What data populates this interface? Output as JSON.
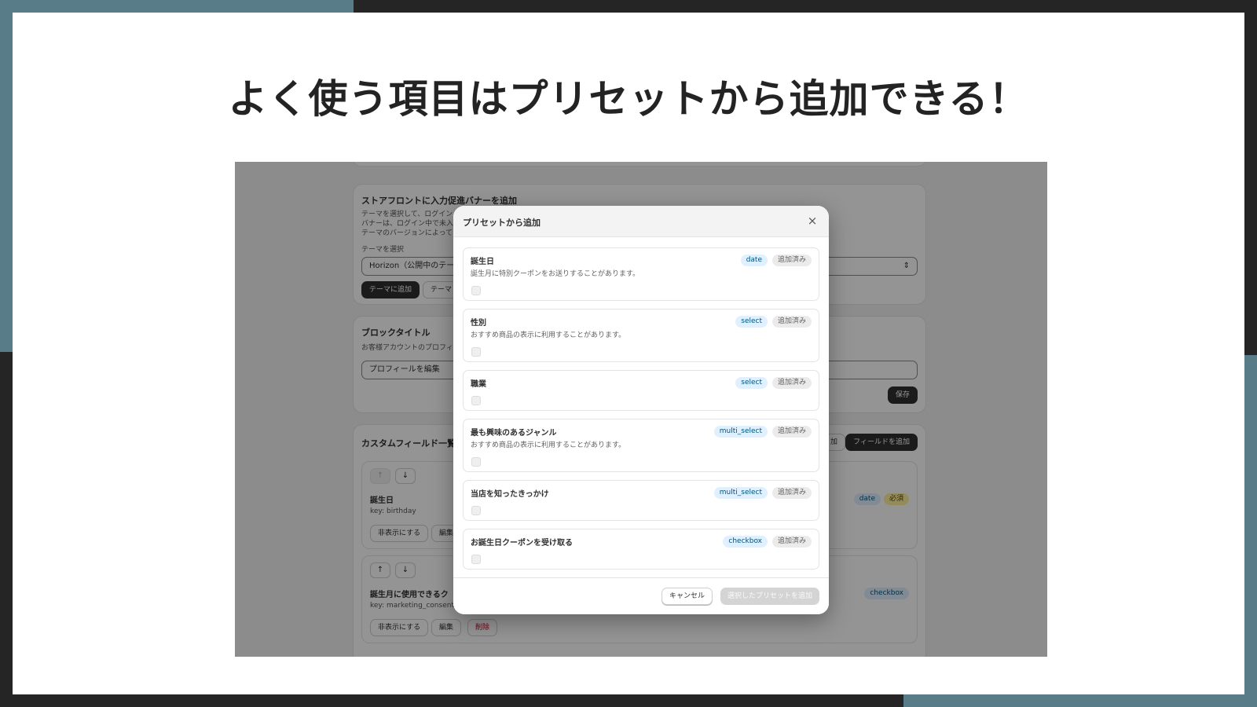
{
  "headline": "よく使う項目はプリセットから追加できる！",
  "app": {
    "banner_card": {
      "title": "ストアフロントに入力促進バナーを追加",
      "lines": [
        "テーマを選択して、ログイン",
        "バナーは、ログイン中で未入",
        "テーマのバージョンによって"
      ],
      "theme_label": "テーマを選択",
      "theme_select_value": "Horizon（公開中のテー",
      "add_to_theme_button": "テーマに追加",
      "theme_button_2": "テーマ"
    },
    "block_card": {
      "title": "ブロックタイトル",
      "desc": "お客様アカウントのプロフィ",
      "input_value": "プロフィールを編集",
      "save_button": "保存"
    },
    "fields_card": {
      "title": "カスタムフィールド一覧",
      "preset_button_partial": "加",
      "add_field_button": "フィールドを追加",
      "fields": [
        {
          "name": "誕生日",
          "key": "key: birthday",
          "hide_button": "非表示にする",
          "edit_button": "編集",
          "badges": [
            "date",
            "必須"
          ]
        },
        {
          "name": "誕生月に使用できるク",
          "key": "key: marketing_consent",
          "hide_button": "非表示にする",
          "edit_button": "編集",
          "delete_button": "削除",
          "badges": [
            "checkbox"
          ]
        }
      ]
    }
  },
  "modal": {
    "title": "プリセットから追加",
    "close_icon": "close-icon",
    "added_label": "追加済み",
    "presets": [
      {
        "name": "誕生日",
        "type": "date",
        "desc": "誕生月に特別クーポンをお送りすることがあります。"
      },
      {
        "name": "性別",
        "type": "select",
        "desc": "おすすめ商品の表示に利用することがあります。"
      },
      {
        "name": "職業",
        "type": "select",
        "desc": ""
      },
      {
        "name": "最も興味のあるジャンル",
        "type": "multi_select",
        "desc": "おすすめ商品の表示に利用することがあります。"
      },
      {
        "name": "当店を知ったきっかけ",
        "type": "multi_select",
        "desc": ""
      },
      {
        "name": "お誕生日クーポンを受け取る",
        "type": "checkbox",
        "desc": ""
      }
    ],
    "cancel_button": "キャンセル",
    "add_selected_button": "選択したプリセットを追加"
  },
  "colors": {
    "slide_frame": "#252525",
    "accent_blocks": "#587d89",
    "overlay": "rgba(0,0,0,0.42)"
  }
}
